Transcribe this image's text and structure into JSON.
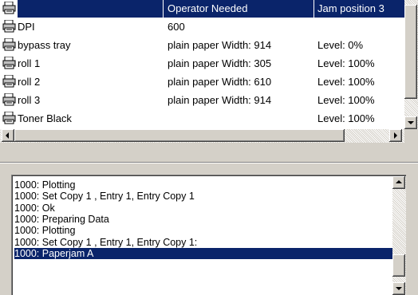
{
  "printer_table": {
    "rows": [
      {
        "icon": "printer-icon",
        "name": "",
        "value": "Operator Needed",
        "status": "Jam position 3",
        "selected": true
      },
      {
        "icon": "printer-icon",
        "name": "DPI",
        "value": "600",
        "status": "",
        "selected": false
      },
      {
        "icon": "printer-icon",
        "name": "bypass tray",
        "value": "plain paper Width: 914",
        "status": "Level: 0%",
        "selected": false
      },
      {
        "icon": "printer-icon",
        "name": "roll 1",
        "value": "plain paper Width: 305",
        "status": "Level: 100%",
        "selected": false
      },
      {
        "icon": "printer-icon",
        "name": "roll 2",
        "value": "plain paper Width: 610",
        "status": "Level: 100%",
        "selected": false
      },
      {
        "icon": "printer-icon",
        "name": "roll 3",
        "value": "plain paper Width: 914",
        "status": "Level: 100%",
        "selected": false
      },
      {
        "icon": "printer-icon",
        "name": "Toner Black",
        "value": "",
        "status": "Level: 100%",
        "selected": false
      }
    ]
  },
  "log": {
    "lines": [
      "1000: Plotting",
      "1000: Set Copy 1 , Entry 1, Entry Copy 1",
      "1000: Ok",
      "1000: Preparing Data",
      "1000: Plotting",
      "1000: Set Copy 1 , Entry 1, Entry Copy 1:",
      "1000: Paperjam A"
    ],
    "selected_index": 6
  },
  "colors": {
    "selection": "#0a246a",
    "window_bg": "#d4d0c8"
  }
}
